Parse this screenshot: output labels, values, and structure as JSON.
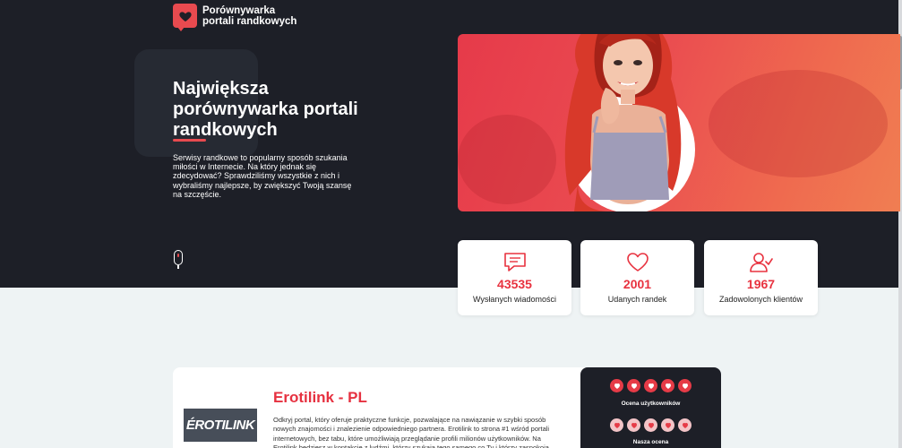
{
  "brand": {
    "line1": "Porównywarka",
    "line2": "portali randkowych",
    "icon": "heart-chat-icon"
  },
  "hero": {
    "title": "Największa porównywarka portali randkowych",
    "description": "Serwisy randkowe to popularny sposób szukania miłości w Internecie. Na który jednak się zdecydować? Sprawdziliśmy wszystkie z nich i wybraliśmy najlepsze, by zwiększyć Twoją szansę na szczęście."
  },
  "stats": [
    {
      "icon": "message-icon",
      "value": "43535",
      "label": "Wysłanych wiadomości"
    },
    {
      "icon": "heart-icon",
      "value": "2001",
      "label": "Udanych randek"
    },
    {
      "icon": "user-check-icon",
      "value": "1967",
      "label": "Zadowolonych klientów"
    }
  ],
  "listing": {
    "logo_text": "ÉROTILINK",
    "title": "Erotilink - PL",
    "description": "Odkryj portal, który oferuje praktyczne funkcje, pozwalające na nawiązanie w szybki sposób nowych znajomości i znalezienie odpowiedniego partnera. Erotilink to strona #1 wśród portali internetowych, bez tabu, które umożliwiają przeglądanie profili milionów użytkowników. Na Erotilink będziesz w kontakcie z ludźmi, którzy szukają tego samego co Ty i którzy zaspokoją",
    "user_rating_label": "Ocena użytkowników",
    "our_rating_label": "Nasza ocena",
    "user_rating": 5,
    "our_rating": 5
  },
  "colors": {
    "accent": "#e8323f",
    "dark": "#1d1f27",
    "background": "#eef3f4"
  }
}
